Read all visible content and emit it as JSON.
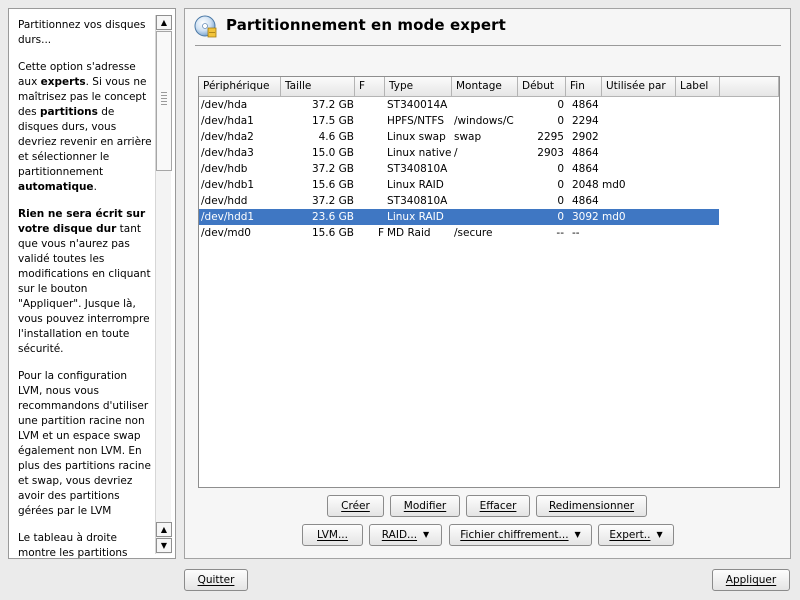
{
  "help": {
    "p1": "Partitionnez vos disques durs...",
    "p2_a": "Cette option s'adresse aux ",
    "p2_b": "experts",
    "p2_c": ". Si vous ne maîtrisez pas le concept des ",
    "p2_d": "partitions",
    "p2_e": " de disques durs, vous devriez revenir en arrière et sélectionner le partitionnement ",
    "p2_f": "automatique",
    "p2_g": ".",
    "p3_a": "Rien ne sera écrit sur votre disque dur",
    "p3_b": " tant que vous n'aurez pas validé toutes les modifications en cliquant sur le bouton \"Appliquer\". Jusque là, vous pouvez interrompre l'installation en toute sécurité.",
    "p4": "Pour la configuration LVM, nous vous recommandons d'utiliser une partition racine non LVM et un espace swap également non LVM. En plus des partitions racine et swap, vous devriez avoir des partitions gérées par le LVM",
    "p5": "Le tableau à droite montre les partitions",
    "scroll_up": "▲",
    "scroll_down": "▼"
  },
  "header": {
    "title": "Partitionnement en mode expert",
    "icon": "disk-partition-icon"
  },
  "table": {
    "columns": [
      "Périphérique",
      "Taille",
      "F",
      "Type",
      "Montage",
      "Début",
      "Fin",
      "Utilisée par",
      "Label"
    ],
    "rows": [
      {
        "device": "/dev/hda",
        "size": "37.2 GB",
        "f": "",
        "type": "ST340014A",
        "mount": "",
        "start": "0",
        "end": "4864",
        "used_by": "",
        "label": ""
      },
      {
        "device": "/dev/hda1",
        "size": "17.5 GB",
        "f": "",
        "type": "HPFS/NTFS",
        "mount": "/windows/C",
        "start": "0",
        "end": "2294",
        "used_by": "",
        "label": ""
      },
      {
        "device": "/dev/hda2",
        "size": "4.6 GB",
        "f": "",
        "type": "Linux swap",
        "mount": "swap",
        "start": "2295",
        "end": "2902",
        "used_by": "",
        "label": ""
      },
      {
        "device": "/dev/hda3",
        "size": "15.0 GB",
        "f": "",
        "type": "Linux native",
        "mount": "/",
        "start": "2903",
        "end": "4864",
        "used_by": "",
        "label": ""
      },
      {
        "device": "/dev/hdb",
        "size": "37.2 GB",
        "f": "",
        "type": "ST340810A",
        "mount": "",
        "start": "0",
        "end": "4864",
        "used_by": "",
        "label": ""
      },
      {
        "device": "/dev/hdb1",
        "size": "15.6 GB",
        "f": "",
        "type": "Linux RAID",
        "mount": "",
        "start": "0",
        "end": "2048",
        "used_by": "md0",
        "label": ""
      },
      {
        "device": "/dev/hdd",
        "size": "37.2 GB",
        "f": "",
        "type": "ST340810A",
        "mount": "",
        "start": "0",
        "end": "4864",
        "used_by": "",
        "label": ""
      },
      {
        "device": "/dev/hdd1",
        "size": "23.6 GB",
        "f": "",
        "type": "Linux RAID",
        "mount": "",
        "start": "0",
        "end": "3092",
        "used_by": "md0",
        "label": ""
      },
      {
        "device": "/dev/md0",
        "size": "15.6 GB",
        "f": "F",
        "type": "MD Raid",
        "mount": "/secure",
        "start": "--",
        "end": "--",
        "used_by": "",
        "label": ""
      }
    ],
    "selected_row": 7
  },
  "buttons": {
    "create": "Créer",
    "edit": "Modifier",
    "delete": "Effacer",
    "resize": "Redimensionner",
    "lvm": "LVM...",
    "raid": "RAID...",
    "crypt": "Fichier chiffrement...",
    "expert": "Expert..",
    "dropdown_arrow": "▼"
  },
  "footer": {
    "quit": "Quitter",
    "apply": "Appliquer"
  },
  "colors": {
    "selection": "#3f77c3",
    "background": "#ebebeb"
  }
}
